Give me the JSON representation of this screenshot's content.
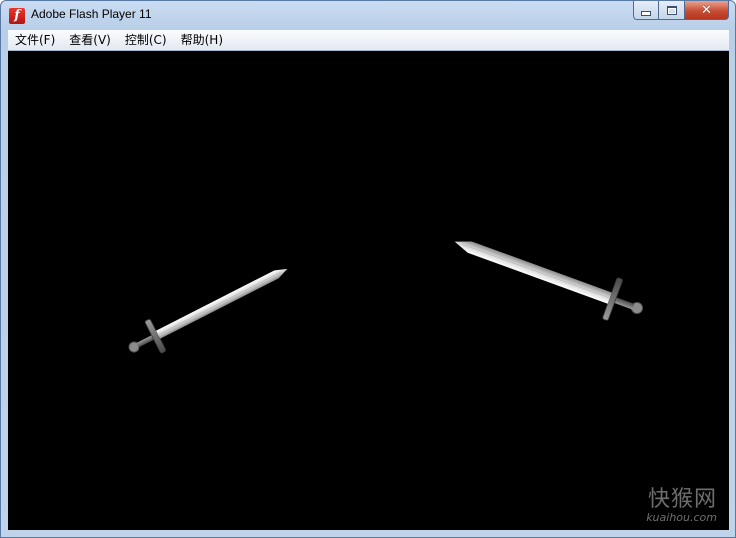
{
  "window": {
    "title": "Adobe Flash Player 11",
    "icon": "flash-player-icon",
    "controls": [
      "minimize",
      "maximize",
      "close"
    ]
  },
  "menu": {
    "items": [
      {
        "label": "文件(F)"
      },
      {
        "label": "查看(V)"
      },
      {
        "label": "控制(C)"
      },
      {
        "label": "帮助(H)"
      }
    ]
  },
  "stage": {
    "background": "#000000",
    "objects": [
      "sword-left",
      "sword-right"
    ]
  },
  "watermark": {
    "brand": "快猴网",
    "domain": "kuaihou.com"
  }
}
